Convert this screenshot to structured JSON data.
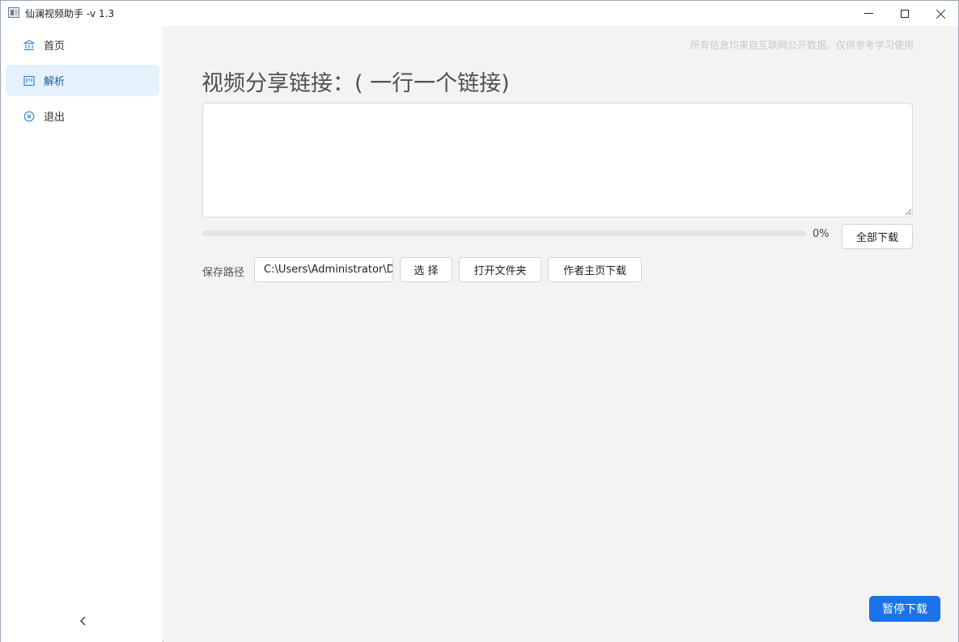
{
  "window": {
    "title": "仙澜视频助手 -v 1.3"
  },
  "sidebar": {
    "items": [
      {
        "label": "首页",
        "icon": "bank-icon"
      },
      {
        "label": "解析",
        "icon": "board-icon"
      },
      {
        "label": "退出",
        "icon": "close-circle-icon"
      }
    ],
    "active_index": 1
  },
  "main": {
    "disclaimer": "所有信息均来自互联网公开数据，仅供参考学习使用",
    "heading": "视频分享链接：( 一行一个链接)",
    "links_value": "",
    "progress": {
      "value": 0,
      "text": "0%"
    },
    "download_all_label": "全部下载",
    "save_path_label": "保存路径",
    "save_path_value": "C:\\Users\\Administrator\\D",
    "choose_label": "选 择",
    "open_folder_label": "打开文件夹",
    "author_download_label": "作者主页下载",
    "pause_label": "暂停下载"
  },
  "colors": {
    "accent": "#1a73e8",
    "active_nav_bg": "#e5f1fb",
    "content_bg": "#f3f3f3"
  }
}
